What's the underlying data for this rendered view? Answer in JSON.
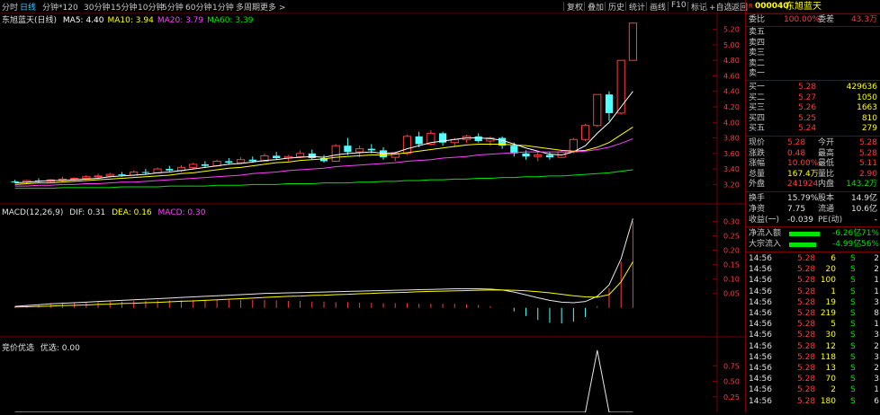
{
  "topbar": {
    "periods": [
      "分时",
      "日线",
      "分钟*120",
      "30分钟",
      "15分钟",
      "10分钟",
      "5分钟",
      "60分钟",
      "1分钟",
      "多周期",
      "更多 >"
    ],
    "active_period": "日线",
    "tools": [
      "复权",
      "叠加",
      "历史",
      "统计",
      "画线",
      "F10",
      "标记",
      "+自选",
      "返回"
    ]
  },
  "kline": {
    "title": "东旭蓝天(日线)",
    "ma_labels": [
      {
        "text": "MA5: 4.40",
        "color": "#ffffff"
      },
      {
        "text": "MA10: 3.94",
        "color": "#ffff00"
      },
      {
        "text": "MA20: 3.79",
        "color": "#ff40ff"
      },
      {
        "text": "MA60: 3.39",
        "color": "#00e600"
      }
    ],
    "y_ticks": [
      "5.20",
      "5.00",
      "4.80",
      "4.60",
      "4.40",
      "4.20",
      "4.00",
      "3.80",
      "3.60",
      "3.40",
      "3.20"
    ]
  },
  "macd": {
    "title": "MACD(12,26,9)",
    "dif": "DIF: 0.31",
    "dea": "DEA: 0.16",
    "macd": "MACD: 0.30",
    "y_ticks": [
      "0.30",
      "0.25",
      "0.20",
      "0.15",
      "0.10",
      "0.05"
    ]
  },
  "bidding": {
    "title": "竞价优选",
    "value": "优选: 0.00",
    "y_ticks": [
      "0.75",
      "0.50",
      "0.25"
    ]
  },
  "chart_data": [
    {
      "type": "candlestick",
      "title": "东旭蓝天(日线)",
      "ylim": [
        3.1,
        5.3
      ],
      "ohlc": [
        [
          3.24,
          3.26,
          3.22,
          3.23
        ],
        [
          3.23,
          3.26,
          3.21,
          3.25
        ],
        [
          3.25,
          3.28,
          3.23,
          3.24
        ],
        [
          3.24,
          3.27,
          3.22,
          3.26
        ],
        [
          3.26,
          3.3,
          3.24,
          3.27
        ],
        [
          3.27,
          3.29,
          3.25,
          3.28
        ],
        [
          3.28,
          3.32,
          3.26,
          3.3
        ],
        [
          3.3,
          3.34,
          3.27,
          3.31
        ],
        [
          3.31,
          3.35,
          3.29,
          3.33
        ],
        [
          3.33,
          3.36,
          3.3,
          3.32
        ],
        [
          3.32,
          3.38,
          3.31,
          3.36
        ],
        [
          3.36,
          3.4,
          3.33,
          3.35
        ],
        [
          3.35,
          3.42,
          3.34,
          3.4
        ],
        [
          3.4,
          3.44,
          3.37,
          3.38
        ],
        [
          3.38,
          3.45,
          3.36,
          3.42
        ],
        [
          3.42,
          3.48,
          3.4,
          3.46
        ],
        [
          3.46,
          3.5,
          3.42,
          3.44
        ],
        [
          3.44,
          3.52,
          3.43,
          3.5
        ],
        [
          3.5,
          3.54,
          3.46,
          3.48
        ],
        [
          3.48,
          3.55,
          3.47,
          3.52
        ],
        [
          3.52,
          3.56,
          3.48,
          3.5
        ],
        [
          3.5,
          3.6,
          3.49,
          3.57
        ],
        [
          3.57,
          3.62,
          3.52,
          3.54
        ],
        [
          3.54,
          3.58,
          3.5,
          3.56
        ],
        [
          3.56,
          3.64,
          3.54,
          3.6
        ],
        [
          3.6,
          3.65,
          3.52,
          3.54
        ],
        [
          3.54,
          3.58,
          3.48,
          3.5
        ],
        [
          3.5,
          3.72,
          3.49,
          3.7
        ],
        [
          3.7,
          3.8,
          3.58,
          3.62
        ],
        [
          3.62,
          3.7,
          3.55,
          3.66
        ],
        [
          3.66,
          3.72,
          3.6,
          3.64
        ],
        [
          3.64,
          3.68,
          3.52,
          3.55
        ],
        [
          3.55,
          3.62,
          3.5,
          3.6
        ],
        [
          3.6,
          3.84,
          3.58,
          3.82
        ],
        [
          3.82,
          3.88,
          3.68,
          3.72
        ],
        [
          3.72,
          3.9,
          3.7,
          3.86
        ],
        [
          3.86,
          3.88,
          3.7,
          3.74
        ],
        [
          3.74,
          3.8,
          3.68,
          3.78
        ],
        [
          3.78,
          3.84,
          3.74,
          3.82
        ],
        [
          3.82,
          3.86,
          3.74,
          3.76
        ],
        [
          3.76,
          3.82,
          3.7,
          3.8
        ],
        [
          3.8,
          3.82,
          3.66,
          3.7
        ],
        [
          3.7,
          3.74,
          3.56,
          3.6
        ],
        [
          3.6,
          3.64,
          3.52,
          3.56
        ],
        [
          3.56,
          3.62,
          3.5,
          3.58
        ],
        [
          3.58,
          3.62,
          3.52,
          3.55
        ],
        [
          3.55,
          3.64,
          3.54,
          3.62
        ],
        [
          3.62,
          3.8,
          3.6,
          3.78
        ],
        [
          3.78,
          3.98,
          3.76,
          3.96
        ],
        [
          3.96,
          4.36,
          3.94,
          4.36
        ],
        [
          4.36,
          4.4,
          4.02,
          4.12
        ],
        [
          4.12,
          4.8,
          4.1,
          4.8
        ],
        [
          4.8,
          5.28,
          4.8,
          5.28
        ]
      ],
      "ma": {
        "MA5": [
          3.22,
          3.23,
          3.24,
          3.25,
          3.25,
          3.26,
          3.27,
          3.28,
          3.3,
          3.31,
          3.32,
          3.33,
          3.35,
          3.36,
          3.38,
          3.4,
          3.42,
          3.44,
          3.46,
          3.47,
          3.49,
          3.51,
          3.52,
          3.54,
          3.55,
          3.56,
          3.55,
          3.58,
          3.6,
          3.61,
          3.62,
          3.6,
          3.61,
          3.66,
          3.7,
          3.74,
          3.76,
          3.78,
          3.8,
          3.8,
          3.79,
          3.77,
          3.72,
          3.67,
          3.63,
          3.59,
          3.58,
          3.62,
          3.7,
          3.86,
          4.0,
          4.2,
          4.4
        ],
        "MA10": [
          3.2,
          3.21,
          3.22,
          3.22,
          3.23,
          3.24,
          3.25,
          3.26,
          3.27,
          3.28,
          3.29,
          3.3,
          3.31,
          3.32,
          3.34,
          3.35,
          3.37,
          3.39,
          3.41,
          3.42,
          3.44,
          3.46,
          3.48,
          3.49,
          3.51,
          3.52,
          3.53,
          3.55,
          3.56,
          3.57,
          3.58,
          3.58,
          3.59,
          3.61,
          3.63,
          3.65,
          3.67,
          3.69,
          3.71,
          3.72,
          3.72,
          3.72,
          3.71,
          3.7,
          3.68,
          3.66,
          3.64,
          3.63,
          3.64,
          3.68,
          3.74,
          3.84,
          3.94
        ],
        "MA20": [
          3.18,
          3.18,
          3.19,
          3.19,
          3.2,
          3.2,
          3.21,
          3.21,
          3.22,
          3.23,
          3.23,
          3.24,
          3.25,
          3.26,
          3.27,
          3.28,
          3.29,
          3.3,
          3.31,
          3.32,
          3.34,
          3.35,
          3.36,
          3.38,
          3.39,
          3.4,
          3.41,
          3.43,
          3.44,
          3.45,
          3.46,
          3.47,
          3.48,
          3.5,
          3.51,
          3.52,
          3.54,
          3.55,
          3.56,
          3.58,
          3.59,
          3.6,
          3.61,
          3.62,
          3.62,
          3.62,
          3.62,
          3.62,
          3.63,
          3.65,
          3.68,
          3.73,
          3.79
        ],
        "MA60": [
          3.15,
          3.15,
          3.15,
          3.15,
          3.16,
          3.16,
          3.16,
          3.16,
          3.16,
          3.17,
          3.17,
          3.17,
          3.17,
          3.18,
          3.18,
          3.18,
          3.18,
          3.19,
          3.19,
          3.19,
          3.2,
          3.2,
          3.2,
          3.21,
          3.21,
          3.21,
          3.22,
          3.22,
          3.22,
          3.23,
          3.23,
          3.24,
          3.24,
          3.25,
          3.25,
          3.26,
          3.26,
          3.27,
          3.27,
          3.28,
          3.28,
          3.29,
          3.29,
          3.3,
          3.3,
          3.31,
          3.31,
          3.32,
          3.33,
          3.34,
          3.35,
          3.37,
          3.39
        ]
      }
    },
    {
      "type": "line",
      "title": "MACD(12,26,9)",
      "ylim": [
        -0.06,
        0.32
      ],
      "series": [
        {
          "name": "DIF",
          "values": [
            0.005,
            0.008,
            0.011,
            0.014,
            0.016,
            0.018,
            0.02,
            0.022,
            0.024,
            0.026,
            0.028,
            0.03,
            0.032,
            0.034,
            0.036,
            0.038,
            0.04,
            0.042,
            0.044,
            0.046,
            0.048,
            0.05,
            0.051,
            0.052,
            0.053,
            0.054,
            0.055,
            0.056,
            0.057,
            0.058,
            0.059,
            0.06,
            0.061,
            0.062,
            0.063,
            0.064,
            0.065,
            0.066,
            0.066,
            0.066,
            0.065,
            0.062,
            0.055,
            0.045,
            0.035,
            0.026,
            0.02,
            0.018,
            0.022,
            0.04,
            0.08,
            0.17,
            0.31
          ]
        },
        {
          "name": "DEA",
          "values": [
            0.003,
            0.004,
            0.005,
            0.006,
            0.008,
            0.009,
            0.01,
            0.012,
            0.013,
            0.015,
            0.016,
            0.018,
            0.019,
            0.021,
            0.023,
            0.024,
            0.026,
            0.028,
            0.03,
            0.032,
            0.034,
            0.036,
            0.038,
            0.04,
            0.041,
            0.043,
            0.044,
            0.046,
            0.047,
            0.049,
            0.05,
            0.052,
            0.053,
            0.054,
            0.056,
            0.057,
            0.058,
            0.059,
            0.06,
            0.061,
            0.062,
            0.062,
            0.061,
            0.059,
            0.056,
            0.052,
            0.047,
            0.042,
            0.038,
            0.037,
            0.046,
            0.09,
            0.16
          ]
        },
        {
          "name": "MACD",
          "values": [
            0.004,
            0.008,
            0.012,
            0.016,
            0.016,
            0.018,
            0.02,
            0.02,
            0.022,
            0.022,
            0.024,
            0.024,
            0.026,
            0.026,
            0.026,
            0.028,
            0.028,
            0.028,
            0.028,
            0.028,
            0.028,
            0.028,
            0.026,
            0.024,
            0.024,
            0.022,
            0.022,
            0.02,
            0.02,
            0.018,
            0.018,
            0.016,
            0.016,
            0.016,
            0.014,
            0.014,
            0.014,
            0.014,
            0.012,
            0.01,
            0.006,
            0.0,
            -0.012,
            -0.028,
            -0.042,
            -0.052,
            -0.054,
            -0.048,
            -0.032,
            0.006,
            0.068,
            0.16,
            0.3
          ]
        }
      ]
    },
    {
      "type": "line",
      "title": "竞价优选",
      "ylim": [
        0,
        1.0
      ],
      "series": [
        {
          "name": "优选",
          "values": [
            0,
            0,
            0,
            0,
            0,
            0,
            0,
            0,
            0,
            0,
            0,
            0,
            0,
            0,
            0,
            0,
            0,
            0,
            0,
            0,
            0,
            0,
            0,
            0,
            0,
            0,
            0,
            0,
            0,
            0,
            0,
            0,
            0,
            0,
            0,
            0,
            0,
            0,
            0,
            0,
            0,
            0,
            0,
            0,
            0,
            0,
            0,
            0,
            0,
            1.0,
            0,
            0,
            0
          ]
        }
      ]
    }
  ],
  "panel": {
    "code": "000040",
    "name": "东旭蓝天",
    "wei_bi_label": "委比",
    "wei_bi": "100.00%",
    "wei_cha_label": "委差",
    "wei_cha": "43.3万",
    "sells": [
      {
        "label": "卖五",
        "price": "",
        "vol": ""
      },
      {
        "label": "卖四",
        "price": "",
        "vol": ""
      },
      {
        "label": "卖三",
        "price": "",
        "vol": ""
      },
      {
        "label": "卖二",
        "price": "",
        "vol": ""
      },
      {
        "label": "卖一",
        "price": "",
        "vol": ""
      }
    ],
    "buys": [
      {
        "label": "买一",
        "price": "5.28",
        "vol": "429636"
      },
      {
        "label": "买二",
        "price": "5.27",
        "vol": "1050"
      },
      {
        "label": "买三",
        "price": "5.26",
        "vol": "1663"
      },
      {
        "label": "买四",
        "price": "5.25",
        "vol": "810"
      },
      {
        "label": "买五",
        "price": "5.24",
        "vol": "279"
      }
    ],
    "quote": [
      {
        "l1": "现价",
        "v1": "5.28",
        "c1": "red",
        "l2": "今开",
        "v2": "5.28",
        "c2": "red"
      },
      {
        "l1": "涨跌",
        "v1": "0.48",
        "c1": "red",
        "l2": "最高",
        "v2": "5.28",
        "c2": "red"
      },
      {
        "l1": "涨幅",
        "v1": "10.00%",
        "c1": "red",
        "l2": "最低",
        "v2": "5.11",
        "c2": "red"
      },
      {
        "l1": "总量",
        "v1": "167.4万",
        "c1": "yel",
        "l2": "量比",
        "v2": "2.90",
        "c2": "red"
      },
      {
        "l1": "外盘",
        "v1": "241924",
        "c1": "red",
        "l2": "内盘",
        "v2": "143.2万",
        "c2": "grn"
      }
    ],
    "finance": [
      {
        "l1": "换手",
        "v1": "15.79%",
        "l2": "股本",
        "v2": "14.9亿"
      },
      {
        "l1": "净资",
        "v1": "7.75",
        "l2": "流通",
        "v2": "10.6亿"
      },
      {
        "l1": "收益(一)",
        "v1": "-0.039",
        "l2": "PE(动)",
        "v2": "-"
      }
    ],
    "flows": [
      {
        "label": "净流入额",
        "value": "-6.26亿",
        "pct": "-71%"
      },
      {
        "label": "大宗流入",
        "value": "-4.99亿",
        "pct": "-56%"
      }
    ],
    "ticks": [
      {
        "time": "14:56",
        "price": "5.28",
        "vol": "6",
        "side": "S",
        "num": "2"
      },
      {
        "time": "14:56",
        "price": "5.28",
        "vol": "20",
        "side": "S",
        "num": "2"
      },
      {
        "time": "14:56",
        "price": "5.28",
        "vol": "100",
        "side": "S",
        "num": "1"
      },
      {
        "time": "14:56",
        "price": "5.28",
        "vol": "1",
        "side": "S",
        "num": "1"
      },
      {
        "time": "14:56",
        "price": "5.28",
        "vol": "19",
        "side": "S",
        "num": "3"
      },
      {
        "time": "14:56",
        "price": "5.28",
        "vol": "219",
        "side": "S",
        "num": "8"
      },
      {
        "time": "14:56",
        "price": "5.28",
        "vol": "5",
        "side": "S",
        "num": "1"
      },
      {
        "time": "14:56",
        "price": "5.28",
        "vol": "30",
        "side": "S",
        "num": "3"
      },
      {
        "time": "14:56",
        "price": "5.28",
        "vol": "12",
        "side": "S",
        "num": "2"
      },
      {
        "time": "14:56",
        "price": "5.28",
        "vol": "118",
        "side": "S",
        "num": "3"
      },
      {
        "time": "14:56",
        "price": "5.28",
        "vol": "13",
        "side": "S",
        "num": "2"
      },
      {
        "time": "14:56",
        "price": "5.28",
        "vol": "70",
        "side": "S",
        "num": "3"
      },
      {
        "time": "14:56",
        "price": "5.28",
        "vol": "2",
        "side": "S",
        "num": "1"
      },
      {
        "time": "14:56",
        "price": "5.28",
        "vol": "180",
        "side": "S",
        "num": "6"
      }
    ]
  },
  "colors": {
    "up": "#ff3c3c",
    "down": "#54ffff",
    "ma5": "#ffffff",
    "ma10": "#ffff00",
    "ma20": "#ff40ff",
    "ma60": "#00e600",
    "grid": "#7a0000",
    "axis_text": "#ff3c3c",
    "active_tab": "#39c8ff"
  }
}
